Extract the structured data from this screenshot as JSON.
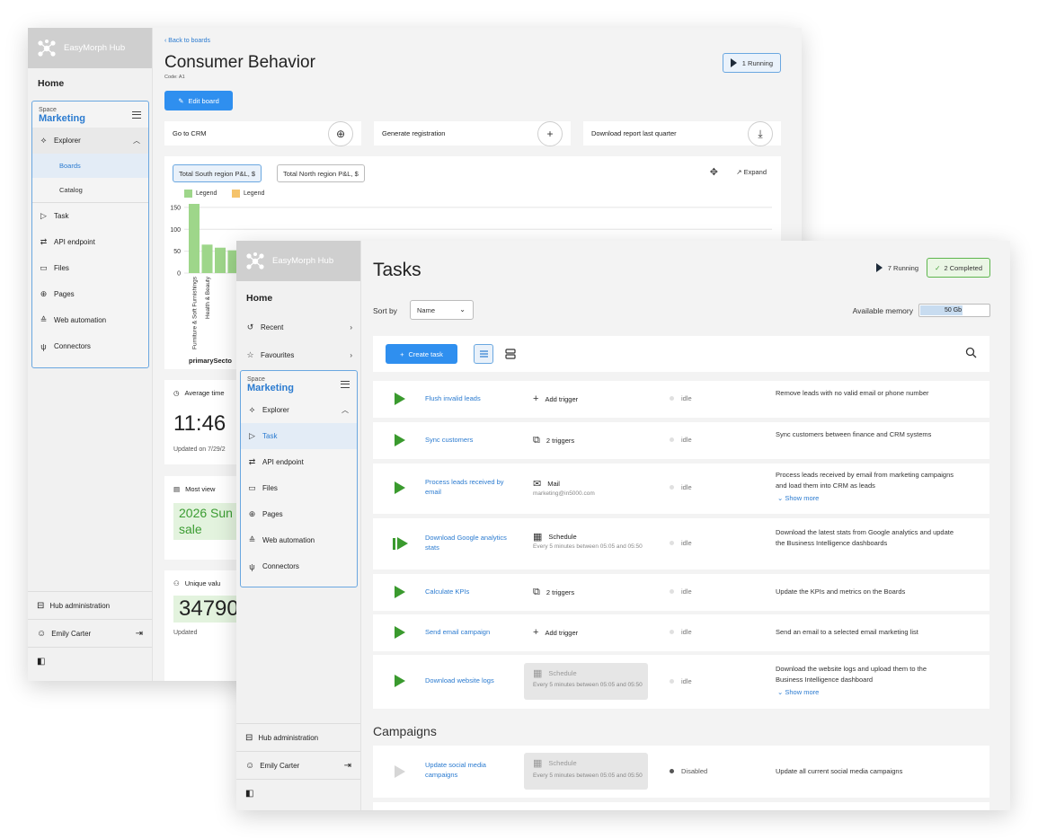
{
  "app": {
    "brand": "EasyMorph Hub",
    "home": "Home"
  },
  "back_window": {
    "sidebar": {
      "space_label": "Space",
      "space_name": "Marketing",
      "explorer": "Explorer",
      "boards": "Boards",
      "catalog": "Catalog",
      "items": [
        "Task",
        "API endpoint",
        "Files",
        "Pages",
        "Web automation",
        "Connectors"
      ],
      "hub_admin": "Hub administration",
      "user": "Emily Carter"
    },
    "back_link": "Back to boards",
    "title": "Consumer Behavior",
    "code_label": "Code:",
    "code_value": "A1",
    "running": "1 Running",
    "edit_board": "Edit board",
    "actions": [
      "Go to CRM",
      "Generate registration",
      "Download report last quarter"
    ],
    "chart_tabs": [
      "Total South region P&L, $",
      "Total North region P&L, $"
    ],
    "expand": "Expand",
    "legend": [
      "Legend",
      "Legend"
    ],
    "stats": {
      "avg_title": "Average time",
      "avg_value": "11:46",
      "avg_updated": "Updated on 7/29/2",
      "most_title": "Most view",
      "most_value": "2026 Sun sale",
      "unique_title": "Unique valu",
      "unique_value": "34790",
      "unique_updated": "Updated"
    }
  },
  "chart_data": {
    "type": "bar",
    "categories": [
      "Furniture & Soft Furnishings",
      "Health & Beauty",
      "",
      "",
      ""
    ],
    "values": [
      158,
      65,
      58,
      52,
      45
    ],
    "xlabel": "primarySecto",
    "yticks": [
      0,
      50,
      100,
      150
    ],
    "ylim": [
      0,
      160
    ],
    "bar_color": "#9ed68a",
    "legend_colors": [
      "#9ed68a",
      "#f5c36b"
    ]
  },
  "front_window": {
    "sidebar": {
      "recent": "Recent",
      "favourites": "Favourites",
      "space_label": "Space",
      "space_name": "Marketing",
      "explorer": "Explorer",
      "items": [
        "Task",
        "API endpoint",
        "Files",
        "Pages",
        "Web automation",
        "Connectors"
      ],
      "hub_admin": "Hub administration",
      "user": "Emily Carter"
    },
    "title": "Tasks",
    "running": "7 Running",
    "completed": "2 Completed",
    "sort_by": "Sort by",
    "sort_value": "Name",
    "available_memory": "Available memory",
    "memory_value": "50 Gb",
    "memory_fill": 0.6,
    "create_task": "Create task",
    "campaigns": "Campaigns",
    "show_more": "Show more",
    "tasks": [
      {
        "name": "Flush invalid leads",
        "trigger": "Add trigger",
        "trigger_icon": "plus",
        "status": "idle",
        "desc": "Remove leads with no valid email or phone number"
      },
      {
        "name": "Sync customers",
        "trigger": "2 triggers",
        "trigger_icon": "layers",
        "status": "idle",
        "desc": "Sync customers between finance and CRM systems"
      },
      {
        "name": "Process leads received by email",
        "trigger": "Mail",
        "trigger_sub": "marketing@in5000.com",
        "trigger_icon": "mail",
        "status": "idle",
        "desc": "Process leads received by email from marketing campaigns and load them into CRM as leads"
      },
      {
        "name": "Download Google analytics stats",
        "trigger": "Schedule",
        "trigger_sub": "Every 5 minutes between 05:05 and 05:50",
        "trigger_icon": "calendar",
        "status": "idle",
        "desc": "Download the latest stats from Google analytics and update the Business Intelligence dashboards"
      },
      {
        "name": "Calculate KPIs",
        "trigger": "2 triggers",
        "trigger_icon": "layers",
        "status": "idle",
        "desc": "Update the KPIs and metrics on the Boards"
      },
      {
        "name": "Send email campaign",
        "trigger": "Add trigger",
        "trigger_icon": "plus",
        "status": "idle",
        "desc": "Send an email to a selected email marketing list"
      },
      {
        "name": "Download website logs",
        "trigger": "Schedule",
        "trigger_sub": "Every 5 minutes between 05:05 and 05:50",
        "trigger_icon": "calendar",
        "status": "idle",
        "desc": "Download the website logs and upload them to the Business Intelligence dashboard"
      }
    ],
    "campaign_task": {
      "name": "Update social media campaigns",
      "trigger": "Schedule",
      "trigger_sub": "Every 5 minutes between 05:05 and 05:50",
      "status": "Disabled",
      "desc": "Update all current social media campaigns"
    }
  }
}
